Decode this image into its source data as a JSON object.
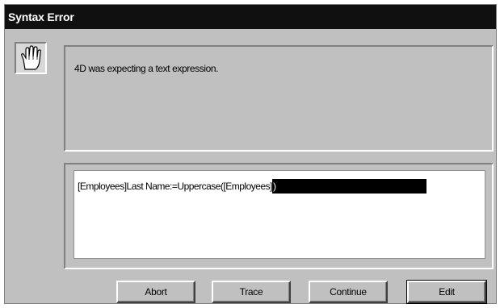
{
  "dialog": {
    "title": "Syntax Error",
    "message": "4D was expecting a text expression.",
    "code_normal": "[Employees]Last Name:=Uppercase([Employees]",
    "code_selected": ")"
  },
  "buttons": {
    "abort": "Abort",
    "trace": "Trace",
    "continue": "Continue",
    "edit": "Edit"
  },
  "icons": {
    "alert": "stop-hand-icon"
  },
  "colors": {
    "titlebar": "#101010",
    "dialog_bg": "#c0c0c0",
    "selection": "#000000"
  }
}
